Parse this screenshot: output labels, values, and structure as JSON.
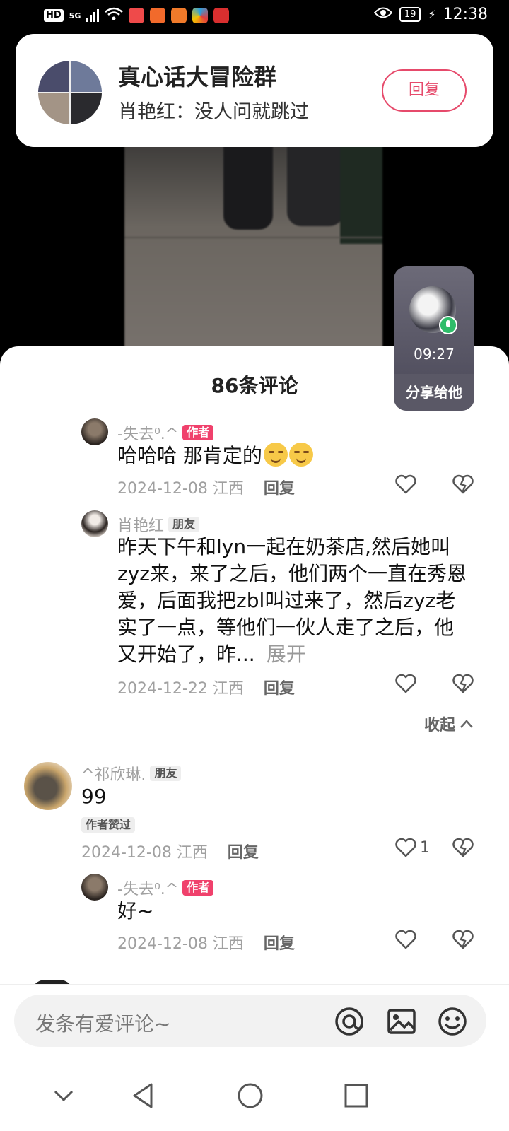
{
  "status_bar": {
    "hd": "HD",
    "network": "5G",
    "battery": "19",
    "time": "12:38",
    "icons": [
      "signal-icon",
      "wifi-icon",
      "eye-icon",
      "charging-icon"
    ],
    "app_colors": [
      "#ef4a4a",
      "#f26a2b",
      "#f07a2a",
      "#2aa0e0",
      "#d92f2f"
    ]
  },
  "notification": {
    "title": "真心话大冒险群",
    "message": "肖艳红：没人问就跳过",
    "reply_label": "回复"
  },
  "comments_header": {
    "count_label": "86条评论"
  },
  "share_card": {
    "time": "09:27",
    "label": "分享给他"
  },
  "comments": [
    {
      "user": "-失去⁰.^",
      "badge": "作者",
      "text": "哈哈哈 那肯定的",
      "date_location": "2024-12-08 江西",
      "reply_label": "回复"
    },
    {
      "user": "肖艳红",
      "badge": "朋友",
      "text": "昨天下午和lyn一起在奶茶店,然后她叫zyz来，来了之后，他们两个一直在秀恩爱，后面我把zbl叫过来了，然后zyz老实了一点，等他们一伙人走了之后，他又开始了，昨...",
      "expand_label": "展开",
      "date_location": "2024-12-22 江西",
      "reply_label": "回复"
    },
    {
      "user": "^祁欣琳.",
      "badge": "朋友",
      "text": "99",
      "liked_badge": "作者赞过",
      "date_location": "2024-12-08 江西",
      "reply_label": "回复",
      "likes": "1"
    },
    {
      "user": "-失去⁰.^",
      "badge": "作者",
      "text": "好~",
      "date_location": "2024-12-08 江西",
      "reply_label": "回复"
    }
  ],
  "collapse_label": "收起",
  "input": {
    "placeholder": "发条有爱评论~"
  },
  "colors": {
    "accent": "#f0416c",
    "reply_border": "#e64a6b",
    "mic": "#2fbd6a"
  }
}
